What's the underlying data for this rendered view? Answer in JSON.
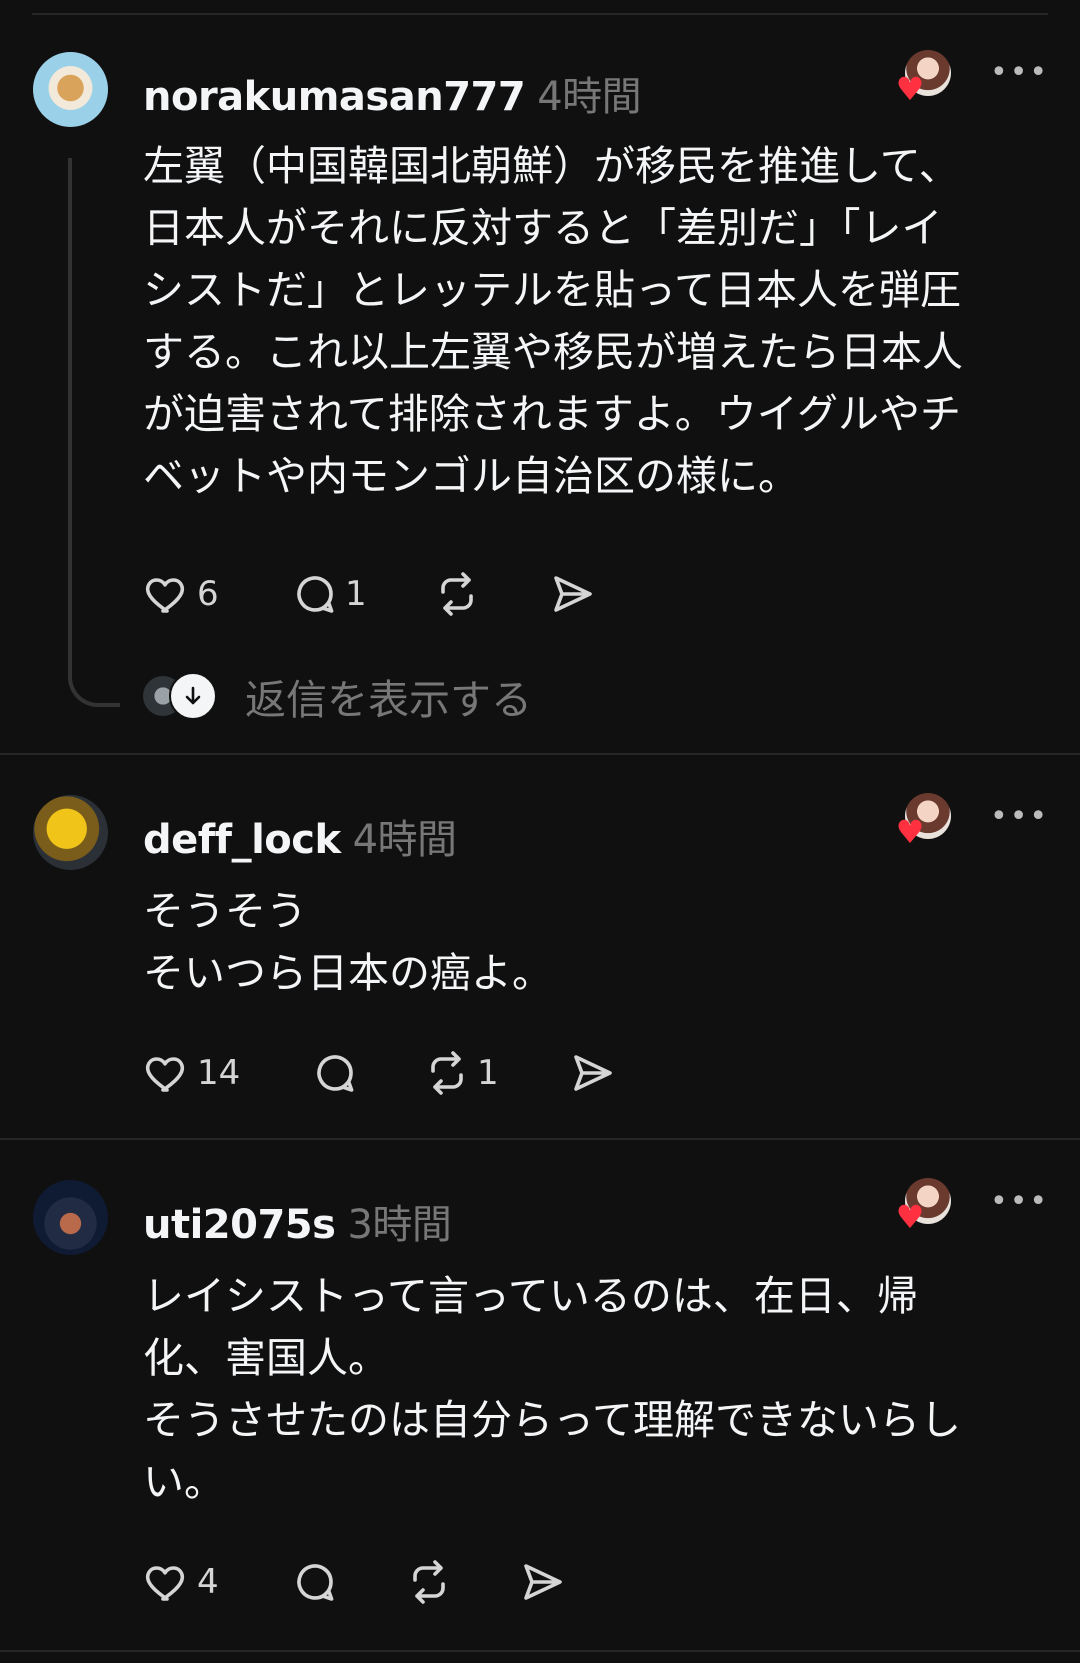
{
  "posts": [
    {
      "username": "norakumasan777",
      "time": "4時間",
      "body": "左翼（中国韓国北朝鮮）が移民を推進して、\n日本人がそれに反対すると「差別だ」「レイ\nシストだ」とレッテルを貼って日本人を弾圧\nする。これ以上左翼や移民が増えたら日本人\nが迫害されて排除されますよ。ウイグルやチ\nベットや内モンゴル自治区の様に。",
      "likes": "6",
      "comments": "1",
      "reposts": "",
      "show_replies": "返信を表示する",
      "icons": [
        "avatar-bear",
        "heart-icon",
        "comment-icon",
        "repost-icon",
        "share-icon"
      ]
    },
    {
      "username": "deff_lock",
      "time": "4時間",
      "body": "そうそう\nそいつら日本の癌よ。",
      "likes": "14",
      "comments": "",
      "reposts": "1"
    },
    {
      "username": "uti2075s",
      "time": "3時間",
      "body": "レイシストって言っているのは、在日、帰\n化、害国人。\nそうさせたのは自分らって理解できないらし\nい。",
      "likes": "4",
      "comments": "",
      "reposts": ""
    }
  ],
  "colors": {
    "background": "#101010",
    "text": "#f3f5f7",
    "muted": "#777777",
    "like_badge": "#ff3040"
  },
  "more_glyph": "•••"
}
